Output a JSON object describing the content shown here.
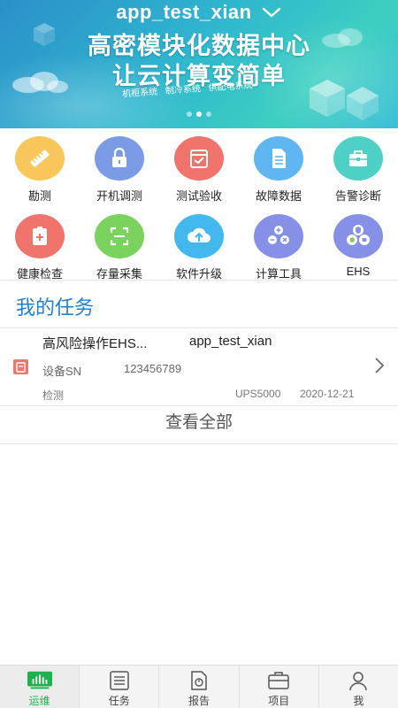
{
  "banner": {
    "title": "app_test_xian",
    "headline_line1": "高密模块化数据中心",
    "headline_line2": "让云计算变简单",
    "systems": [
      "机柜系统",
      "制冷系统",
      "供配电系统"
    ]
  },
  "grid": {
    "items": [
      {
        "label": "勘测",
        "icon": "ruler-icon",
        "color": "#f8c65a"
      },
      {
        "label": "开机调测",
        "icon": "lock-icon",
        "color": "#7b9be6"
      },
      {
        "label": "测试验收",
        "icon": "calendar-check-icon",
        "color": "#f0736c"
      },
      {
        "label": "故障数据",
        "icon": "document-list-icon",
        "color": "#5fb6f0"
      },
      {
        "label": "告警诊断",
        "icon": "toolbox-icon",
        "color": "#4fd0c4"
      },
      {
        "label": "健康检查",
        "icon": "medical-kit-icon",
        "color": "#f0736c"
      },
      {
        "label": "存量采集",
        "icon": "scan-frame-icon",
        "color": "#79d35d"
      },
      {
        "label": "软件升级",
        "icon": "cloud-upload-icon",
        "color": "#42b8ef"
      },
      {
        "label": "计算工具",
        "icon": "calculator-icon",
        "color": "#8590e6"
      },
      {
        "label": "EHS",
        "icon": "ehs-shield-icon",
        "color": "#8590e6"
      }
    ]
  },
  "tasks": {
    "section_title": "我的任务",
    "items": [
      {
        "title": "高风险操作EHS...",
        "user": "app_test_xian",
        "sn_label": "设备SN",
        "sn_value": "123456789",
        "type": "检测",
        "model": "UPS5000",
        "date": "2020-12-21"
      }
    ],
    "view_all": "查看全部"
  },
  "nav": {
    "items": [
      {
        "label": "运维",
        "icon": "ops-chart-icon",
        "active": true
      },
      {
        "label": "任务",
        "icon": "task-list-icon",
        "active": false
      },
      {
        "label": "报告",
        "icon": "report-icon",
        "active": false
      },
      {
        "label": "项目",
        "icon": "project-icon",
        "active": false
      },
      {
        "label": "我",
        "icon": "user-icon",
        "active": false
      }
    ]
  },
  "colors": {
    "accent_blue": "#1f7fd1",
    "nav_active": "#1fb24c",
    "task_flag": "#f0756a"
  }
}
